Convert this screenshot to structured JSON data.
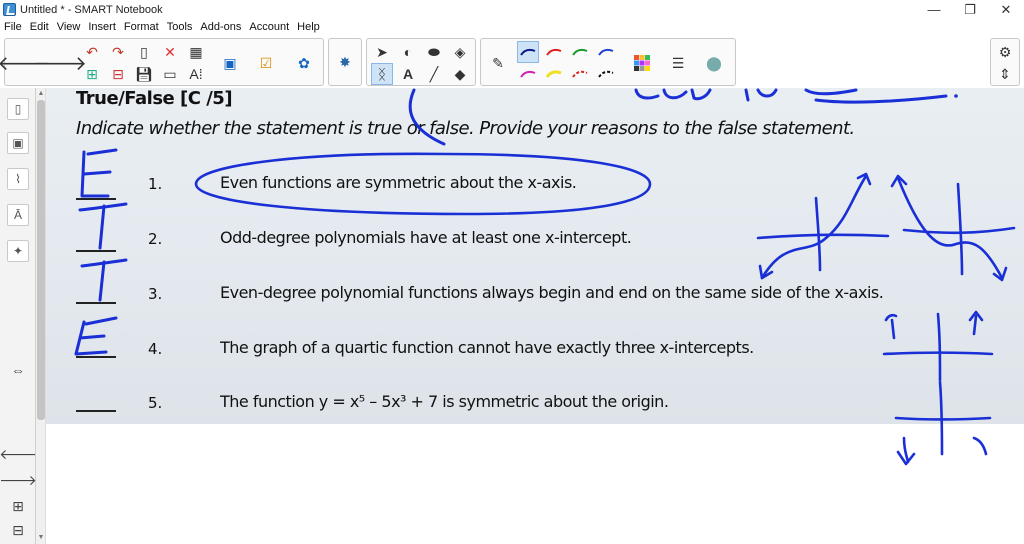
{
  "window": {
    "title": "Untitled * - SMART Notebook",
    "minimize": "—",
    "restore": "❐",
    "close": "✕"
  },
  "menu": [
    "File",
    "Edit",
    "View",
    "Insert",
    "Format",
    "Tools",
    "Add-ons",
    "Account",
    "Help"
  ],
  "toolbar": {
    "icons": [
      "back-arrow-icon",
      "forward-arrow-icon",
      "undo-icon",
      "redo-icon",
      "delete-icon",
      "table-icon",
      "screen-shade-icon",
      "measurement-tools-icon",
      "add-ons-icon",
      "select-icon",
      "pen-icon",
      "text-icon",
      "line-icon",
      "eraser-icon",
      "fill-icon",
      "properties-icon",
      "settings-icon"
    ],
    "text_tool_label": "A",
    "active_pen": "pen-blue-1"
  },
  "colors": {
    "ink_blue": "#1a2fd6",
    "worksheet_bg": "#e5eaef",
    "toolbar_accent": "#cfe3f7"
  },
  "worksheet": {
    "title": "True/False [C       /5]",
    "instructions": "Indicate whether the statement is true or false. Provide your reasons to the false statement.",
    "questions": [
      {
        "number": "1.",
        "statement": "Even functions are symmetric about the x-axis."
      },
      {
        "number": "2.",
        "statement": "Odd-degree polynomials have at least one x-intercept."
      },
      {
        "number": "3.",
        "statement": "Even-degree polynomial functions always begin and end on the same side of the x-axis."
      },
      {
        "number": "4.",
        "statement": "The graph of a quartic function cannot have exactly three x-intercepts."
      },
      {
        "number": "5.",
        "statement": "The function y = x⁵ – 5x³ + 7 is symmetric about the origin."
      }
    ]
  },
  "annotations": {
    "answers": [
      "F",
      "T",
      "T",
      "F"
    ],
    "top_note": "about the y-axis."
  }
}
